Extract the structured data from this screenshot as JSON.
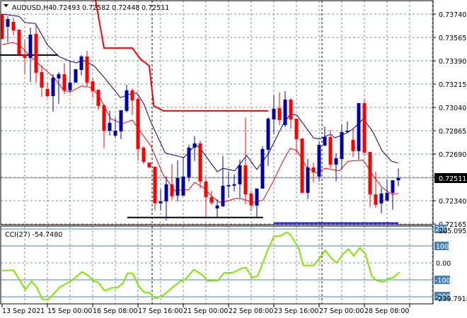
{
  "header": {
    "menu_icon": "triangle-down-icon",
    "symbol": "AUDUSD,H4",
    "ohlc": [
      "0.72493",
      "0.72582",
      "0.72448",
      "0.72511"
    ]
  },
  "price_axis": {
    "ticks": [
      "0.73740",
      "0.73565",
      "0.73390",
      "0.73215",
      "0.73040",
      "0.72865",
      "0.72690",
      "0.72340",
      "0.72165"
    ],
    "current_price": "0.72511"
  },
  "time_axis": {
    "labels": [
      "13 Sep 2021",
      "15 Sep 00:00",
      "16 Sep 08:00",
      "17 Sep 16:00",
      "21 Sep 00:00",
      "22 Sep 08:00",
      "23 Sep 16:00",
      "27 Sep 00:00",
      "28 Sep 08:00"
    ]
  },
  "cci": {
    "label": "CCI(27) -54.7480",
    "levels": [
      "100",
      "-100",
      "200",
      "-200"
    ],
    "zero_label": "0.00",
    "max_label": "205.0955",
    "min_label": "-239.7918"
  },
  "colors": {
    "bull": "#0000a8",
    "bear": "#ff0000",
    "ma_upper": "#000080",
    "ma_lower": "#ff0000",
    "stop_line": "#ff0000",
    "cci_line": "#7fe800",
    "level_box": "#4682b4",
    "grid": "#7f8c9a"
  },
  "chart_data": {
    "type": "candlestick",
    "price_range": [
      0.72165,
      0.7374
    ],
    "candles": [
      [
        0.7374,
        0.7374,
        0.73554,
        0.73554
      ],
      [
        0.73645,
        0.73724,
        0.73528,
        0.73703
      ],
      [
        0.73682,
        0.73713,
        0.73581,
        0.73618
      ],
      [
        0.73623,
        0.73623,
        0.73438,
        0.73438
      ],
      [
        0.73438,
        0.73544,
        0.73289,
        0.73411
      ],
      [
        0.73411,
        0.73639,
        0.73231,
        0.73586
      ],
      [
        0.73592,
        0.73666,
        0.73226,
        0.733
      ],
      [
        0.73305,
        0.73353,
        0.7312,
        0.73189
      ],
      [
        0.73178,
        0.73226,
        0.73115,
        0.73125
      ],
      [
        0.73125,
        0.73289,
        0.73009,
        0.73263
      ],
      [
        0.73258,
        0.73305,
        0.73067,
        0.73289
      ],
      [
        0.73289,
        0.73369,
        0.73141,
        0.73168
      ],
      [
        0.73168,
        0.73385,
        0.73146,
        0.73226
      ],
      [
        0.73226,
        0.73327,
        0.73226,
        0.73327
      ],
      [
        0.73321,
        0.73433,
        0.73279,
        0.73422
      ],
      [
        0.73422,
        0.73464,
        0.73199,
        0.73226
      ],
      [
        0.73236,
        0.73263,
        0.73115,
        0.73162
      ],
      [
        0.73173,
        0.73173,
        0.73024,
        0.73051
      ],
      [
        0.73056,
        0.73067,
        0.72733,
        0.72865
      ],
      [
        0.72865,
        0.73014,
        0.72828,
        0.72924
      ],
      [
        0.72828,
        0.72961,
        0.72812,
        0.72865
      ],
      [
        0.7286,
        0.73019,
        0.72802,
        0.73019
      ],
      [
        0.73014,
        0.7321,
        0.73003,
        0.73168
      ],
      [
        0.73168,
        0.73183,
        0.72982,
        0.73093
      ],
      [
        0.73104,
        0.7312,
        0.72643,
        0.72728
      ],
      [
        0.72738,
        0.72749,
        0.72616,
        0.72632
      ],
      [
        0.72627,
        0.72627,
        0.7259,
        0.7259
      ],
      [
        0.72595,
        0.72595,
        0.72267,
        0.7232
      ],
      [
        0.7232,
        0.72426,
        0.72267,
        0.72335
      ],
      [
        0.72335,
        0.72521,
        0.72192,
        0.72463
      ],
      [
        0.72463,
        0.72616,
        0.72346,
        0.72373
      ],
      [
        0.72378,
        0.72643,
        0.72335,
        0.7251
      ],
      [
        0.72378,
        0.72669,
        0.72378,
        0.72521
      ],
      [
        0.72516,
        0.72759,
        0.72484,
        0.72738
      ],
      [
        0.72738,
        0.72823,
        0.72638,
        0.7277
      ],
      [
        0.7277,
        0.72791,
        0.72431,
        0.72484
      ],
      [
        0.72484,
        0.72505,
        0.72214,
        0.72367
      ],
      [
        0.72367,
        0.72415,
        0.72309,
        0.72325
      ],
      [
        0.72282,
        0.72351,
        0.72214,
        0.72304
      ],
      [
        0.72298,
        0.72675,
        0.72293,
        0.72452
      ],
      [
        0.72447,
        0.72558,
        0.72362,
        0.72457
      ],
      [
        0.72452,
        0.72537,
        0.7241,
        0.72463
      ],
      [
        0.72463,
        0.72648,
        0.72357,
        0.72606
      ],
      [
        0.72606,
        0.72961,
        0.72314,
        0.72388
      ],
      [
        0.72394,
        0.72415,
        0.72261,
        0.72304
      ],
      [
        0.72304,
        0.72431,
        0.72219,
        0.72431
      ],
      [
        0.72431,
        0.72749,
        0.72431,
        0.72728
      ],
      [
        0.72722,
        0.72966,
        0.726,
        0.72956
      ],
      [
        0.7295,
        0.73131,
        0.72839,
        0.7303
      ],
      [
        0.73035,
        0.73152,
        0.72908,
        0.72945
      ],
      [
        0.72908,
        0.73162,
        0.72892,
        0.73099
      ],
      [
        0.73099,
        0.73109,
        0.72881,
        0.7295
      ],
      [
        0.72956,
        0.72956,
        0.72691,
        0.72802
      ],
      [
        0.72807,
        0.72807,
        0.72399,
        0.72399
      ],
      [
        0.72399,
        0.72653,
        0.72351,
        0.7259
      ],
      [
        0.7259,
        0.72627,
        0.72479,
        0.72553
      ],
      [
        0.72521,
        0.72786,
        0.72484,
        0.72759
      ],
      [
        0.72754,
        0.72897,
        0.72749,
        0.72818
      ],
      [
        0.72818,
        0.72871,
        0.72585,
        0.72611
      ],
      [
        0.72611,
        0.72696,
        0.72484,
        0.72659
      ],
      [
        0.72653,
        0.72913,
        0.72574,
        0.72855
      ],
      [
        0.72855,
        0.72934,
        0.7285,
        0.72865
      ],
      [
        0.72797,
        0.72876,
        0.72669,
        0.72712
      ],
      [
        0.72712,
        0.73072,
        0.72648,
        0.73072
      ],
      [
        0.73072,
        0.73104,
        0.72675,
        0.72701
      ],
      [
        0.72706,
        0.72706,
        0.72293,
        0.72388
      ],
      [
        0.72388,
        0.72558,
        0.72288,
        0.72309
      ],
      [
        0.7232,
        0.72436,
        0.72245,
        0.72394
      ],
      [
        0.72341,
        0.725,
        0.72335,
        0.72399
      ],
      [
        0.72399,
        0.72494,
        0.72272,
        0.72494
      ],
      [
        0.72493,
        0.72582,
        0.72448,
        0.72511
      ]
    ],
    "ma_upper": [
      [
        0,
        0.7374
      ],
      [
        3,
        0.73723
      ],
      [
        4,
        0.73678
      ],
      [
        5.9,
        0.73669
      ],
      [
        8,
        0.7351
      ],
      [
        10,
        0.73422
      ],
      [
        12,
        0.73387
      ],
      [
        13.2,
        0.73374
      ],
      [
        14.2,
        0.73396
      ],
      [
        16.3,
        0.73351
      ],
      [
        18.4,
        0.73246
      ],
      [
        20.9,
        0.73113
      ],
      [
        22.5,
        0.73139
      ],
      [
        23.8,
        0.73148
      ],
      [
        25,
        0.73069
      ],
      [
        26.3,
        0.72928
      ],
      [
        28.8,
        0.72698
      ],
      [
        32.1,
        0.72663
      ],
      [
        34.2,
        0.7276
      ],
      [
        35,
        0.72733
      ],
      [
        38,
        0.72557
      ],
      [
        39,
        0.72583
      ],
      [
        41.1,
        0.72565
      ],
      [
        43.2,
        0.7268
      ],
      [
        45,
        0.72574
      ],
      [
        47.1,
        0.72698
      ],
      [
        49.6,
        0.7291
      ],
      [
        50.9,
        0.72989
      ],
      [
        52.1,
        0.72981
      ],
      [
        55,
        0.72812
      ],
      [
        56.1,
        0.72803
      ],
      [
        58,
        0.72839
      ],
      [
        58.8,
        0.72812
      ],
      [
        60.9,
        0.72848
      ],
      [
        62.1,
        0.72883
      ],
      [
        63.8,
        0.72954
      ],
      [
        65.5,
        0.72857
      ],
      [
        67.1,
        0.72716
      ],
      [
        68.8,
        0.72636
      ],
      [
        70,
        0.72622
      ]
    ],
    "ma_lower": [
      [
        0,
        0.7351
      ],
      [
        1.9,
        0.73528
      ],
      [
        3,
        0.7351
      ],
      [
        3.8,
        0.73475
      ],
      [
        5,
        0.73422
      ],
      [
        7.1,
        0.73343
      ],
      [
        9.2,
        0.73263
      ],
      [
        10.9,
        0.73166
      ],
      [
        12.1,
        0.73157
      ],
      [
        14,
        0.73201
      ],
      [
        15.5,
        0.73192
      ],
      [
        17.1,
        0.7313
      ],
      [
        19.2,
        0.72954
      ],
      [
        21.3,
        0.72918
      ],
      [
        23,
        0.72945
      ],
      [
        24.6,
        0.72848
      ],
      [
        26.3,
        0.7275
      ],
      [
        28.4,
        0.72539
      ],
      [
        30.5,
        0.72415
      ],
      [
        33,
        0.72424
      ],
      [
        34,
        0.72477
      ],
      [
        35.5,
        0.72441
      ],
      [
        37.1,
        0.72371
      ],
      [
        38.4,
        0.72326
      ],
      [
        39.6,
        0.72335
      ],
      [
        41.3,
        0.72358
      ],
      [
        42.5,
        0.72353
      ],
      [
        44.2,
        0.72326
      ],
      [
        46.1,
        0.72344
      ],
      [
        48,
        0.72494
      ],
      [
        49.6,
        0.72636
      ],
      [
        50.9,
        0.72733
      ],
      [
        52.1,
        0.72716
      ],
      [
        53.8,
        0.72592
      ],
      [
        55.5,
        0.72548
      ],
      [
        57.1,
        0.72583
      ],
      [
        59.6,
        0.72565
      ],
      [
        61.1,
        0.72636
      ],
      [
        63.8,
        0.72645
      ],
      [
        65.5,
        0.7253
      ],
      [
        67.1,
        0.72441
      ],
      [
        68.8,
        0.72388
      ],
      [
        70,
        0.72394
      ]
    ],
    "stop_line": [
      [
        16.5,
        0.73846
      ],
      [
        18,
        0.73486
      ],
      [
        23,
        0.73486
      ],
      [
        24.5,
        0.734
      ],
      [
        26,
        0.73353
      ],
      [
        26.8,
        0.73051
      ],
      [
        28.5,
        0.73014
      ],
      [
        47,
        0.73014
      ]
    ],
    "hlines": [
      {
        "from": -0.5,
        "to": 9.9,
        "price": 0.73433,
        "color": "#000000"
      },
      {
        "from": 22.1,
        "to": 46.1,
        "price": 0.72214,
        "color": "#000000"
      },
      {
        "from": 48,
        "to": 70,
        "price": 0.72172,
        "color": "#0000ff"
      }
    ],
    "period_separators": [
      26,
      56
    ],
    "cci_range": [
      -239.7918,
      205.0955
    ],
    "cci_values": [
      [
        0,
        -46
      ],
      [
        2,
        -43
      ],
      [
        4.1,
        -157
      ],
      [
        5.2,
        -108
      ],
      [
        6.1,
        -143
      ],
      [
        7.1,
        -215
      ],
      [
        8.2,
        -215
      ],
      [
        10.2,
        -143
      ],
      [
        12.3,
        -104
      ],
      [
        14.1,
        -53
      ],
      [
        15.2,
        -74
      ],
      [
        16.2,
        -108
      ],
      [
        17,
        -115
      ],
      [
        18.1,
        -164
      ],
      [
        19.4,
        -147
      ],
      [
        20.3,
        -147
      ],
      [
        21.3,
        -122
      ],
      [
        22.2,
        -60
      ],
      [
        23.1,
        -63
      ],
      [
        24.1,
        -136
      ],
      [
        25.1,
        -174
      ],
      [
        26,
        -174
      ],
      [
        27,
        -210
      ],
      [
        28.4,
        -192
      ],
      [
        30.2,
        -143
      ],
      [
        31.5,
        -108
      ],
      [
        32.3,
        -99
      ],
      [
        33.9,
        -39
      ],
      [
        35.5,
        -74
      ],
      [
        36.3,
        -106
      ],
      [
        38.1,
        -104
      ],
      [
        39.2,
        -60
      ],
      [
        40.8,
        -57
      ],
      [
        42.3,
        -32
      ],
      [
        43.1,
        -28
      ],
      [
        44.2,
        -88
      ],
      [
        45.2,
        -74
      ],
      [
        46.8,
        65
      ],
      [
        48,
        156
      ],
      [
        49.2,
        160
      ],
      [
        50.3,
        181
      ],
      [
        51,
        163
      ],
      [
        52.4,
        86
      ],
      [
        53.2,
        -15
      ],
      [
        55,
        -15
      ],
      [
        56,
        24
      ],
      [
        57.1,
        75
      ],
      [
        58.2,
        26
      ],
      [
        59.1,
        0
      ],
      [
        60.2,
        51
      ],
      [
        61.2,
        82
      ],
      [
        62.1,
        42
      ],
      [
        63.2,
        90
      ],
      [
        64.2,
        51
      ],
      [
        65.3,
        -78
      ],
      [
        66.2,
        -104
      ],
      [
        67.4,
        -112
      ],
      [
        68.2,
        -94
      ],
      [
        69.2,
        -85
      ],
      [
        70.2,
        -54.748
      ]
    ]
  }
}
